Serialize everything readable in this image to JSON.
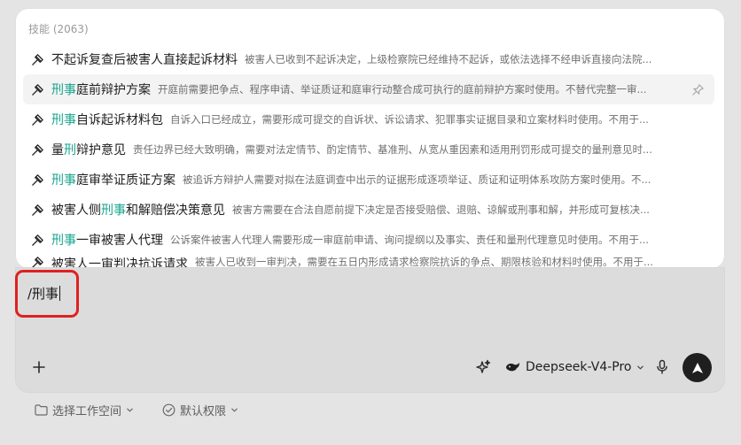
{
  "skills_panel": {
    "header": "技能 (2063)",
    "items": [
      {
        "segments": [
          {
            "text": "不起诉复查后被害人直接起诉材料",
            "hl": false
          }
        ],
        "desc": "被害人已收到不起诉决定，上级检察院已经维持不起诉，或依法选择不经申诉直接向法院...",
        "active": false
      },
      {
        "segments": [
          {
            "text": "刑事",
            "hl": true
          },
          {
            "text": "庭前辩护方案",
            "hl": false
          }
        ],
        "desc": "开庭前需要把争点、程序申请、举证质证和庭审行动整合成可执行的庭前辩护方案时使用。不替代完整一审...",
        "active": true
      },
      {
        "segments": [
          {
            "text": "刑事",
            "hl": true
          },
          {
            "text": "自诉起诉材料包",
            "hl": false
          }
        ],
        "desc": "自诉入口已经成立，需要形成可提交的自诉状、诉讼请求、犯罪事实证据目录和立案材料时使用。不用于...",
        "active": false
      },
      {
        "segments": [
          {
            "text": "量",
            "hl": false
          },
          {
            "text": "刑",
            "hl": true
          },
          {
            "text": "辩护意见",
            "hl": false
          }
        ],
        "desc": "责任边界已经大致明确，需要对法定情节、酌定情节、基准刑、从宽从重因素和适用刑罚形成可提交的量刑意见时...",
        "active": false
      },
      {
        "segments": [
          {
            "text": "刑事",
            "hl": true
          },
          {
            "text": "庭审举证质证方案",
            "hl": false
          }
        ],
        "desc": "被追诉方辩护人需要对拟在法庭调查中出示的证据形成逐项举证、质证和证明体系攻防方案时使用。不...",
        "active": false
      },
      {
        "segments": [
          {
            "text": "被害人侧",
            "hl": false
          },
          {
            "text": "刑事",
            "hl": true
          },
          {
            "text": "和解赔偿决策意见",
            "hl": false
          }
        ],
        "desc": "被害方需要在合法自愿前提下决定是否接受赔偿、退赔、谅解或刑事和解，并形成可复核决...",
        "active": false
      },
      {
        "segments": [
          {
            "text": "刑事",
            "hl": true
          },
          {
            "text": "一审被害人代理",
            "hl": false
          }
        ],
        "desc": "公诉案件被害人代理人需要形成一审庭前申请、询问提纲以及事实、责任和量刑代理意见时使用。不用于...",
        "active": false
      },
      {
        "segments": [
          {
            "text": "被害人一审判决抗诉请求",
            "hl": false
          }
        ],
        "desc": "被害人已收到一审判决，需要在五日内形成请求检察院抗诉的争点、期限核验和材料时使用。不用于...",
        "active": false,
        "partial": true
      }
    ]
  },
  "composer": {
    "input_value": "/刑事",
    "model_name": "Deepseek-V4-Pro"
  },
  "footer": {
    "workspace_label": "选择工作空间",
    "permission_label": "默认权限"
  },
  "colors": {
    "highlight": "#16a48e",
    "annotation": "#e02020",
    "send_button": "#1f1f1f"
  },
  "icons": {
    "skill": "skill-icon",
    "pin": "pin-icon",
    "add": "plus-icon",
    "sparkle": "sparkle-icon",
    "model": "whale-icon",
    "mic": "microphone-icon",
    "send": "arrow-up-icon",
    "folder": "folder-icon",
    "shield": "check-circle-icon"
  }
}
